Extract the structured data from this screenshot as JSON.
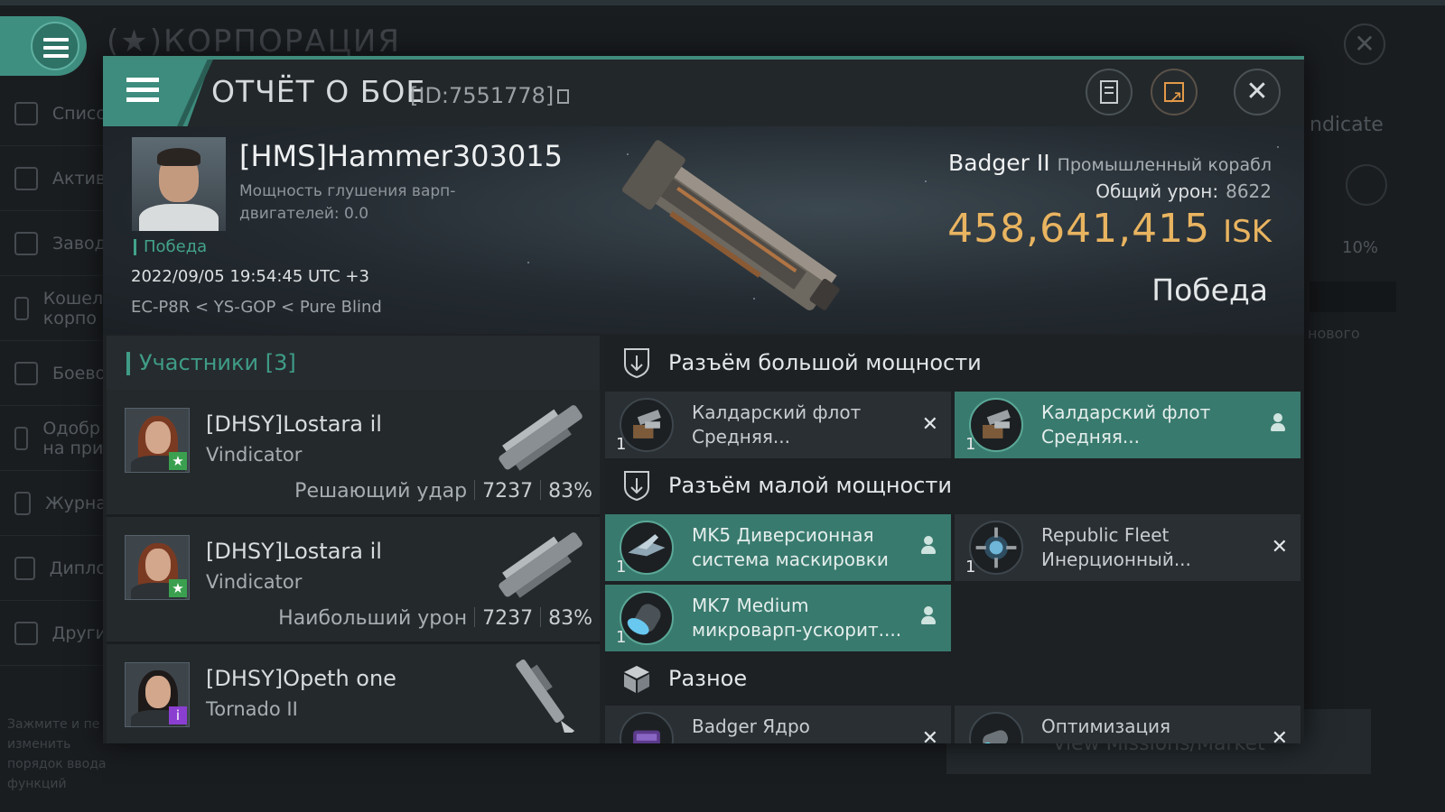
{
  "background": {
    "title": "КОРПОРАЦИЯ",
    "sidebar": [
      "Списо",
      "Актив",
      "Завод",
      "Кошел корпо",
      "Боево",
      "Одобр на при",
      "Журна",
      "Дипло",
      "Други"
    ],
    "hint": "Зажмите и пе изменить порядок ввода функций",
    "right_text": "ndicate",
    "right_pct": "10%",
    "right_new": "нового",
    "missions": "View Missions/Market"
  },
  "header": {
    "title": "ОТЧЁТ О БОЕ",
    "id": "[ID:7551778]"
  },
  "victim": {
    "name": "[HMS]Hammer303015",
    "stat": "Мощность глушения варп-двигателей: 0.0",
    "result_small": "Победа",
    "datetime": "2022/09/05 19:54:45 UTC +3",
    "location": "EC-P8R < YS-GOP < Pure Blind",
    "ship_name": "Badger II",
    "ship_class": "Промышленный корабл",
    "total_damage_label": "Общий урон:",
    "total_damage": "8622",
    "isk_value": "458,641,415",
    "isk_unit": "ISK",
    "result": "Победа"
  },
  "participants": {
    "title": "Участники [3]",
    "rows": [
      {
        "name": "[DHSY]Lostara il",
        "ship": "Vindicator",
        "role": "Решающий удар",
        "damage": "7237",
        "percent": "83%"
      },
      {
        "name": "[DHSY]Lostara il",
        "ship": "Vindicator",
        "role": "Наибольший урон",
        "damage": "7237",
        "percent": "83%"
      },
      {
        "name": "[DHSY]Opeth one",
        "ship": "Tornado II"
      }
    ]
  },
  "fittings": {
    "high": {
      "title": "Разъём большой мощности",
      "slots": [
        {
          "qty": "1",
          "name": "Калдарский флот Средняя...",
          "state": "destroyed"
        },
        {
          "qty": "1",
          "name": "Калдарский флот Средняя...",
          "state": "dropped"
        }
      ]
    },
    "low": {
      "title": "Разъём малой мощности",
      "slots": [
        {
          "qty": "1",
          "name": "MK5 Диверсионная система маскировки",
          "state": "dropped"
        },
        {
          "qty": "1",
          "name": "Republic Fleet Инерционный...",
          "state": "destroyed"
        },
        {
          "qty": "1",
          "name": "MK7 Medium микроварп-ускорит....",
          "state": "dropped"
        }
      ]
    },
    "misc": {
      "title": "Разное",
      "slots": [
        {
          "name": "Badger Ядро",
          "state": "destroyed"
        },
        {
          "name": "Оптимизация",
          "state": "destroyed"
        }
      ]
    }
  },
  "icons": {
    "destroyed": "✕",
    "dropped": "person-icon"
  },
  "colors": {
    "accent": "#3f9c87",
    "isk": "#e9b460",
    "highlight_slot": "#397a6e",
    "share": "#e39a48"
  }
}
